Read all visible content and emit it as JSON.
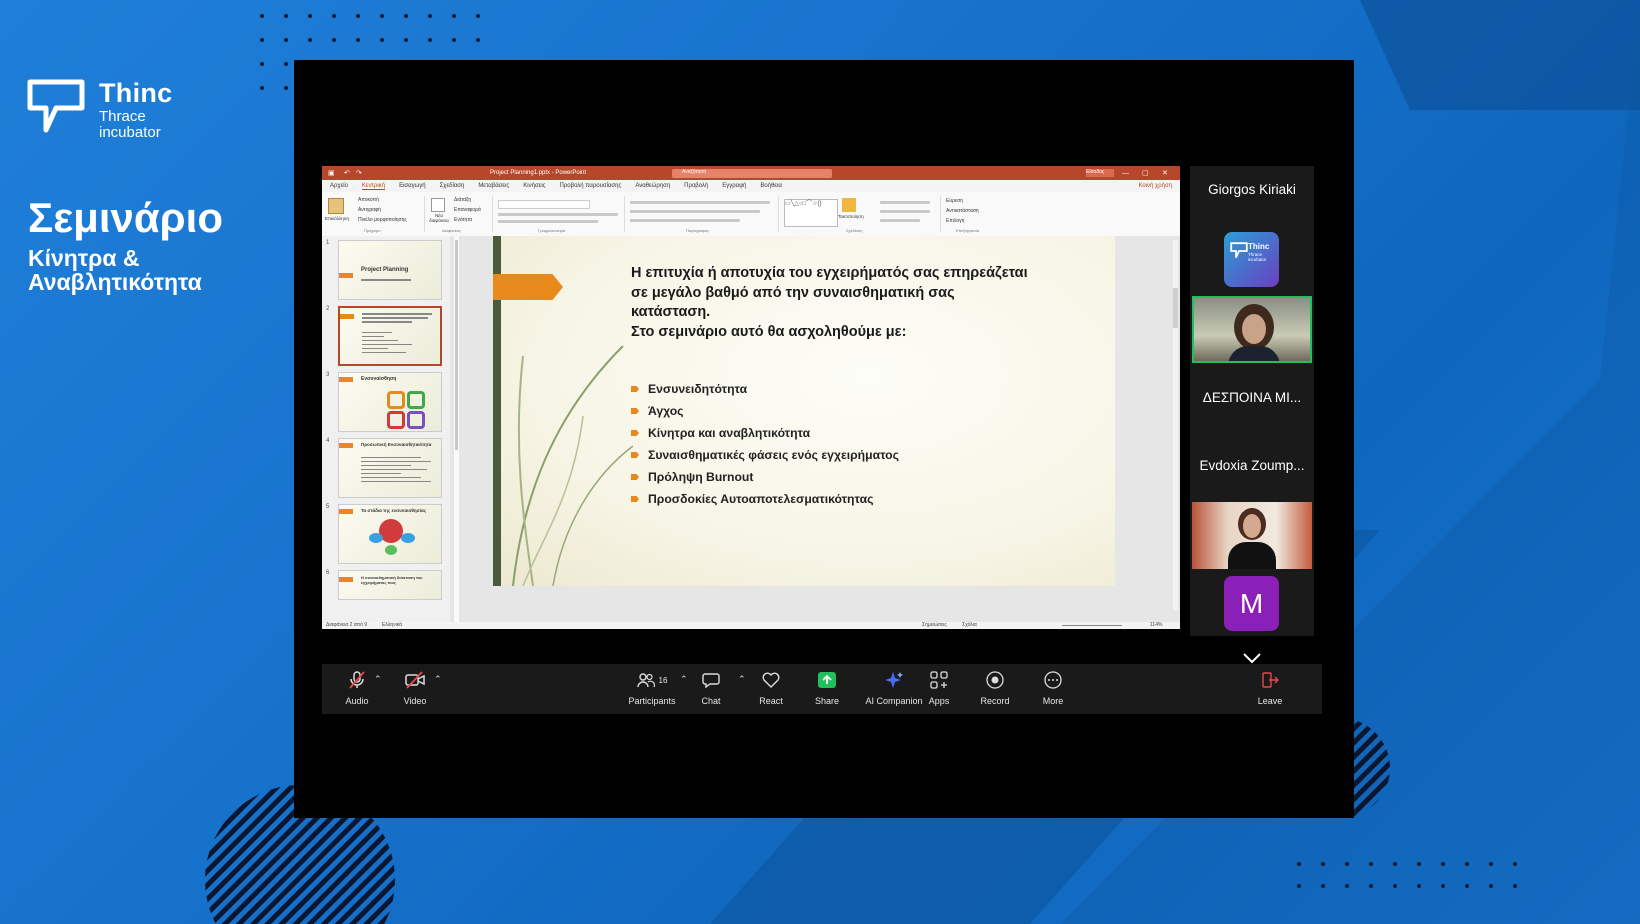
{
  "brand": {
    "name": "Thinc",
    "line1": "Thrace",
    "line2": "incubator"
  },
  "seminar": {
    "title": "Σεμινάριο",
    "subtitle": "Κίνητρα & Αναβλητικότητα"
  },
  "ppt": {
    "window_title": "Project Planning1.pptx - PowerPoint",
    "search_placeholder": "Αναζήτηση",
    "signin": "Είσοδος",
    "menu": [
      "Αρχείο",
      "Κεντρική",
      "Εισαγωγή",
      "Σχεδίαση",
      "Μεταβάσεις",
      "Κινήσεις",
      "Προβολή παρουσίασης",
      "Αναθεώρηση",
      "Προβολή",
      "Εγγραφή",
      "Βοήθεια"
    ],
    "active_menu": "Κεντρική",
    "share_button": "Κοινή χρήση",
    "ribbon_groups": [
      "Πρόχειρο",
      "Διαφάνειες",
      "Γραμματοσειρά",
      "Παράγραφος",
      "Σχεδίαση",
      "Επεξεργασία"
    ],
    "ribbon_items": {
      "paste": "Επικόλληση",
      "cut": "Αποκοπή",
      "copy": "Αντιγραφή",
      "format_painter": "Πινέλο μορφοποίησης",
      "new_slide": "Νέα διαφάνεια",
      "layout": "Διάταξη",
      "reset": "Επαναφορά",
      "section": "Ενότητα",
      "find": "Εύρεση",
      "replace": "Αντικατάσταση",
      "select": "Επιλογή",
      "arrange": "Τακτοποίηση"
    },
    "status": {
      "slide_info": "Διαφάνεια 2 από 9",
      "language": "Ελληνικά",
      "notes": "Σημειώσεις",
      "comments": "Σχόλια",
      "zoom": "114%"
    },
    "thumbnails": [
      {
        "num": "1",
        "title": "Project Planning",
        "selected": false
      },
      {
        "num": "2",
        "title": "",
        "selected": true
      },
      {
        "num": "3",
        "title": "Ενσυναίσθηση",
        "selected": false
      },
      {
        "num": "4",
        "title": "Προσωπική Ενσυναισθητικότητα",
        "selected": false
      },
      {
        "num": "5",
        "title": "Τα στάδια της ενσυναισθησίας",
        "selected": false
      },
      {
        "num": "6",
        "title": "Η συναισθηματική διάσταση του εγχειρήματος τους",
        "selected": false
      }
    ],
    "slide": {
      "heading_lines": [
        "Η επιτυχία ή αποτυχία του εγχειρήματός σας επηρεάζεται",
        "σε μεγάλο βαθμό από την συναισθηματική σας",
        "κατάσταση.",
        "Στο σεμινάριο αυτό θα ασχοληθούμε με:"
      ],
      "bullets": [
        "Ενσυνειδητότητα",
        "Άγχος",
        "Κίνητρα και αναβλητικότητα",
        "Συναισθηματικές φάσεις ενός εγχειρήματος",
        "Πρόληψη Burnout",
        "Προσδοκίες Αυτοαποτελεσματικότητας"
      ]
    }
  },
  "participants": {
    "p1": "Giorgos Kiriaki",
    "p2_logo": "Thinc",
    "p2_logo_sub": "Thrace incubator",
    "p3": "ΔΕΣΠΟΙΝΑ ΜΙ...",
    "p4": "Evdoxia Zoump...",
    "p5_initial": "M"
  },
  "toolbar": {
    "audio": "Audio",
    "video": "Video",
    "participants": "Participants",
    "participants_count": "16",
    "chat": "Chat",
    "react": "React",
    "share": "Share",
    "ai": "AI Companion",
    "apps": "Apps",
    "record": "Record",
    "more": "More",
    "leave": "Leave"
  },
  "colors": {
    "ppt_accent": "#b7472a",
    "slide_accent": "#e8891c",
    "share_green": "#20c05c",
    "active_speaker": "#20c05c",
    "bg_blue": "#1772cc"
  }
}
